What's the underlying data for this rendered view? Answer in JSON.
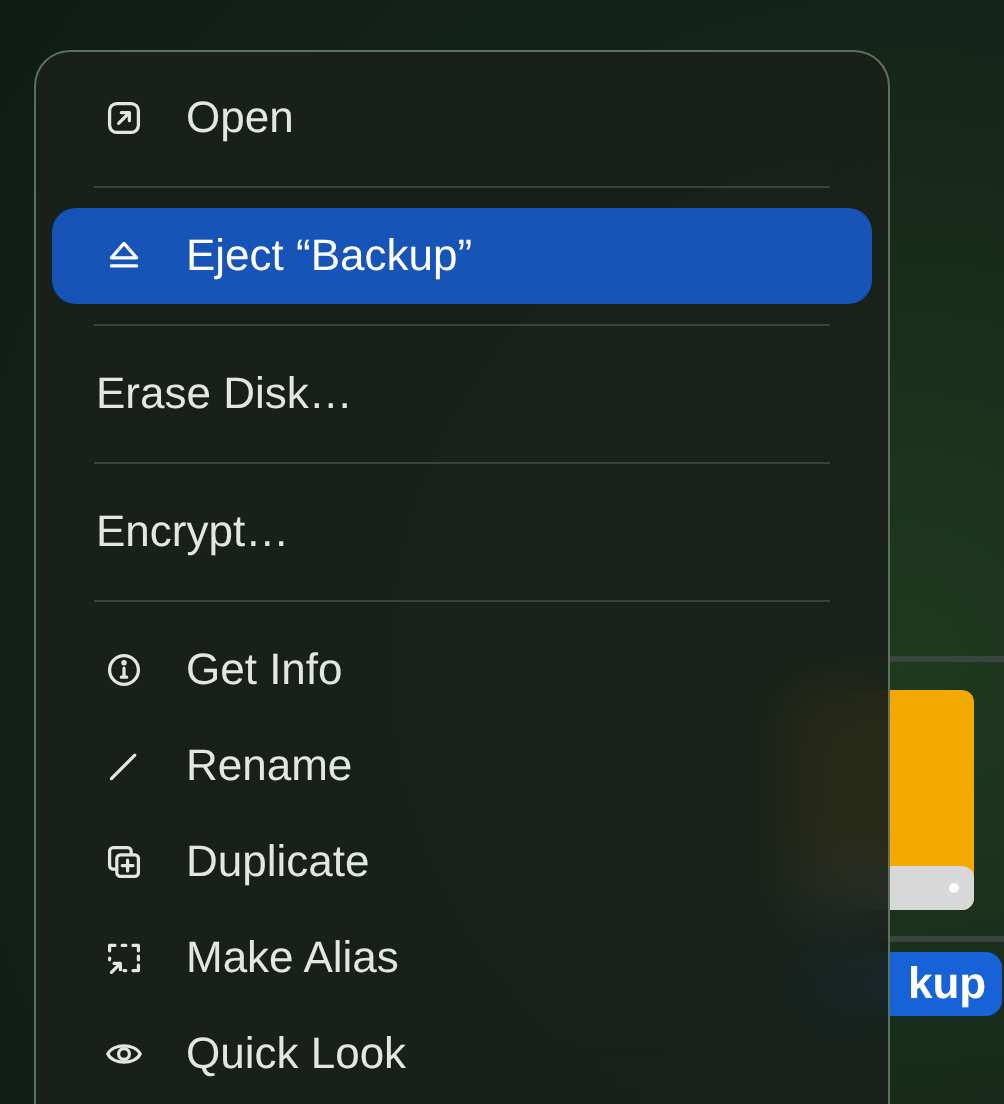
{
  "desktop": {
    "drive_label": "kup"
  },
  "menu": {
    "sections": [
      [
        {
          "label": "Open",
          "kind": "icon",
          "selected": false
        }
      ],
      [
        {
          "label": "Eject “Backup”",
          "kind": "icon",
          "selected": true
        }
      ],
      [
        {
          "label": "Erase Disk…",
          "kind": "text",
          "selected": false
        }
      ],
      [
        {
          "label": "Encrypt…",
          "kind": "text",
          "selected": false
        }
      ],
      [
        {
          "label": "Get Info",
          "kind": "icon",
          "selected": false
        },
        {
          "label": "Rename",
          "kind": "icon",
          "selected": false
        },
        {
          "label": "Duplicate",
          "kind": "icon",
          "selected": false
        },
        {
          "label": "Make Alias",
          "kind": "icon",
          "selected": false
        },
        {
          "label": "Quick Look",
          "kind": "icon",
          "selected": false
        }
      ]
    ]
  }
}
